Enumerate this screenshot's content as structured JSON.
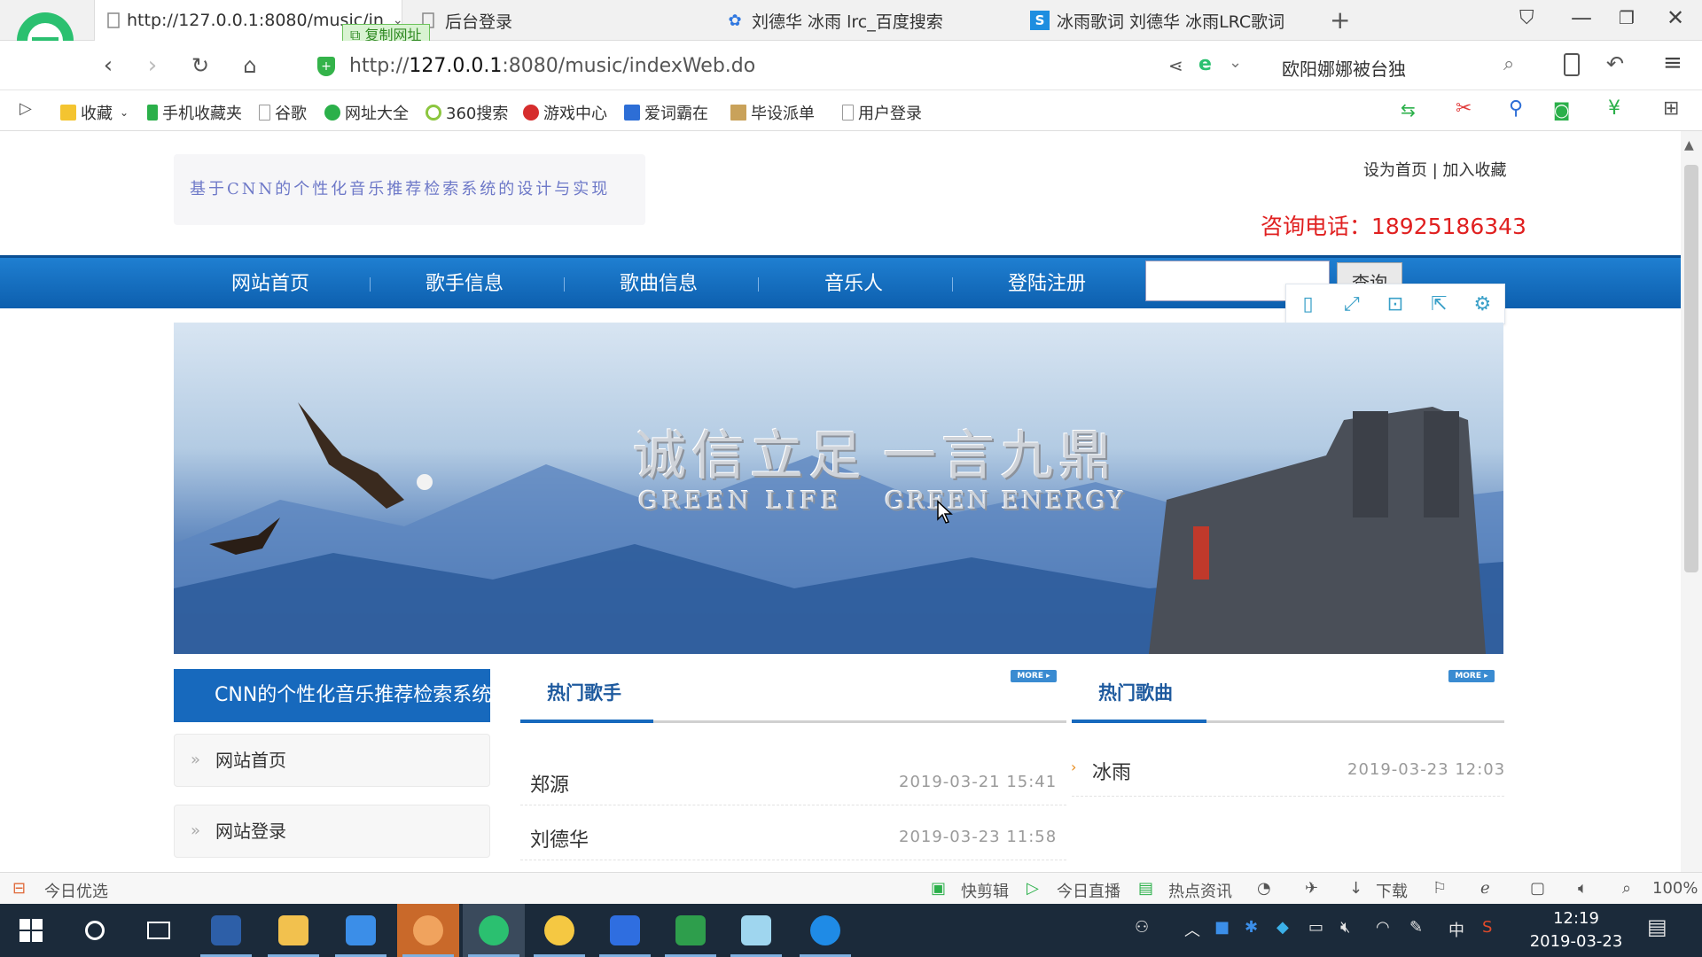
{
  "browser": {
    "tabs": [
      {
        "label": "http://127.0.0.1:8080/music/in",
        "active": true
      },
      {
        "label": "后台登录"
      },
      {
        "label": "刘德华 冰雨 lrc_百度搜索"
      },
      {
        "label": "冰雨歌词 刘德华 冰雨LRC歌词"
      }
    ],
    "copy_url_label": "复制网址",
    "url_prefix": "http://",
    "url_host": "127.0.0.1",
    "url_rest": ":8080/music/indexWeb.do",
    "search_engine_text": "欧阳娜娜被台独",
    "bookmarks": [
      "收藏",
      "手机收藏夹",
      "谷歌",
      "网址大全",
      "360搜索",
      "游戏中心",
      "爱词霸在",
      "毕设派单",
      "用户登录"
    ],
    "status_left": "今日优选",
    "status_items": [
      "快剪辑",
      "今日直播",
      "热点资讯",
      "下载"
    ],
    "zoom": "100%"
  },
  "site": {
    "logo_text": "基于CNN的个性化音乐推荐检索系统的设计与实现",
    "set_home": "设为首页",
    "separator": "|",
    "add_fav": "加入收藏",
    "phone": "咨询电话：18925186343",
    "nav": [
      "网站首页",
      "歌手信息",
      "歌曲信息",
      "音乐人",
      "登陆注册"
    ],
    "search_button": "查询",
    "banner": {
      "cn_left": "诚信立足",
      "cn_right": "一言九鼎",
      "en_left": "GREEN LIFE",
      "en_right": "GREEN ENERGY"
    },
    "sidebar": {
      "title": "CNN的个性化音乐推荐检索系统",
      "items": [
        "网站首页",
        "网站登录"
      ]
    },
    "hot_singers": {
      "title": "热门歌手",
      "more": "MORE ▸",
      "rows": [
        {
          "name": "郑源",
          "date": "2019-03-21 15:41"
        },
        {
          "name": "刘德华",
          "date": "2019-03-23 11:58"
        }
      ]
    },
    "hot_songs": {
      "title": "热门歌曲",
      "more": "MORE ▸",
      "rows": [
        {
          "name": "冰雨",
          "date": "2019-03-23 12:03"
        }
      ]
    }
  },
  "taskbar": {
    "ime": "中",
    "time": "12:19",
    "date": "2019-03-23"
  },
  "colors": {
    "nav_blue": "#0d5fae",
    "phone_red": "#e02020",
    "side_blue": "#1769bd"
  }
}
